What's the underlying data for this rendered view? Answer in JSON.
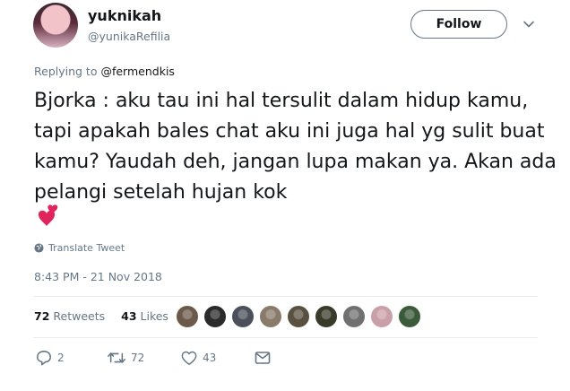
{
  "user": {
    "display_name": "yuknikah",
    "handle": "@yunikaRefilia",
    "avatar_icon": "profile-photo"
  },
  "follow_label": "Follow",
  "reply_context": {
    "prefix": "Replying to",
    "mention": "@fermendkis"
  },
  "tweet": {
    "text": "Bjorka : aku tau ini hal tersulit dalam hidup kamu, tapi apakah bales chat aku ini juga hal yg sulit buat kamu? Yaudah deh, jangan lupa makan ya. Akan ada pelangi setelah hujan kok",
    "emoji_icon": "two-hearts-icon",
    "translate_label": "Translate Tweet",
    "timestamp": "8:43 PM - 21 Nov 2018"
  },
  "stats": {
    "retweets_count": "72",
    "retweets_label": "Retweets",
    "likes_count": "43",
    "likes_label": "Likes"
  },
  "likers": [
    {
      "color": "#6b5a4a"
    },
    {
      "color": "#2a2a2a"
    },
    {
      "color": "#4a4f5a"
    },
    {
      "color": "#8a7a6a"
    },
    {
      "color": "#5a5040"
    },
    {
      "color": "#3a3a2a"
    },
    {
      "color": "#707070"
    },
    {
      "color": "#c9a0a8"
    },
    {
      "color": "#3a5a3a"
    }
  ],
  "actions": {
    "reply_count": "2",
    "retweet_count": "72",
    "like_count": "43"
  },
  "colors": {
    "text": "#14171a",
    "secondary": "#657786",
    "border": "#e6ecf0",
    "heart": "#e0245e"
  }
}
